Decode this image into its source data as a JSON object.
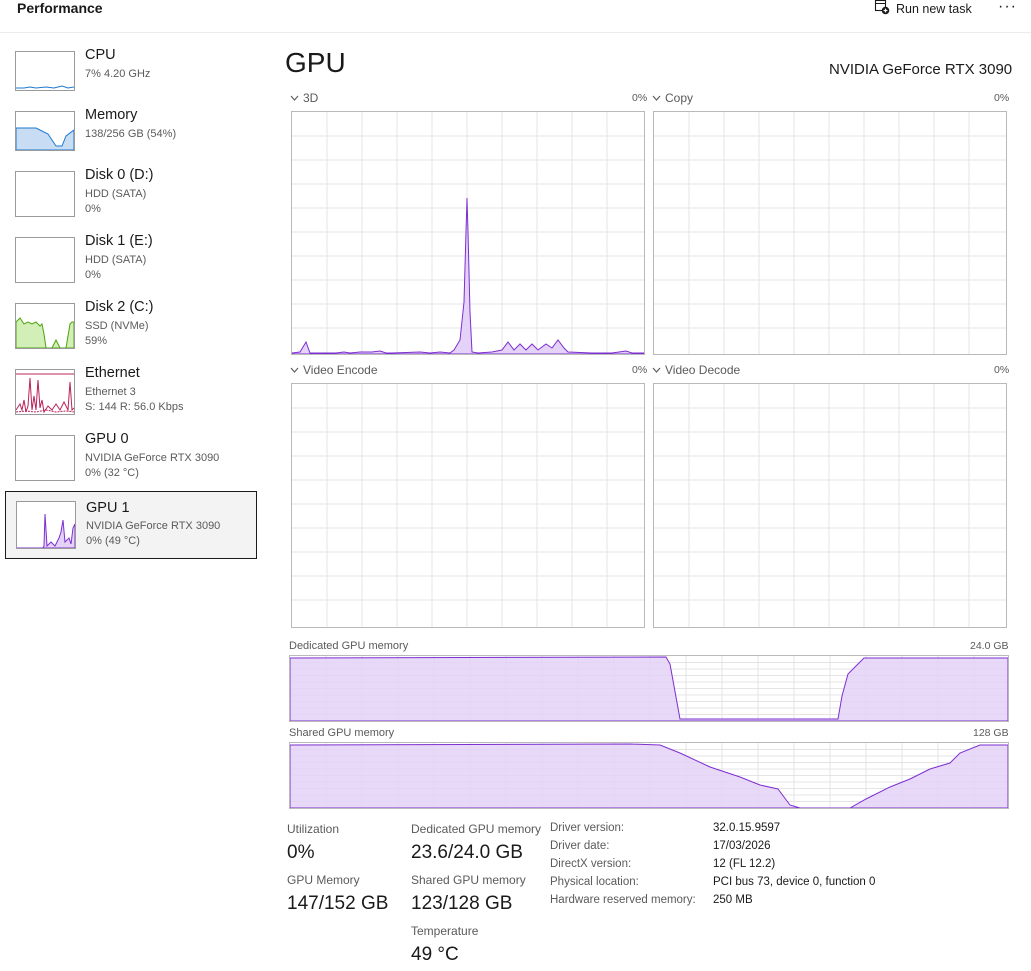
{
  "header": {
    "title": "Performance",
    "run_new_task_label": "Run new task",
    "more_label": "···"
  },
  "sidebar": {
    "items": [
      {
        "title": "CPU",
        "sub1": "7%  4.20 GHz",
        "sub2": ""
      },
      {
        "title": "Memory",
        "sub1": "138/256 GB (54%)",
        "sub2": ""
      },
      {
        "title": "Disk 0 (D:)",
        "sub1": "HDD (SATA)",
        "sub2": "0%"
      },
      {
        "title": "Disk 1 (E:)",
        "sub1": "HDD (SATA)",
        "sub2": "0%"
      },
      {
        "title": "Disk 2 (C:)",
        "sub1": "SSD (NVMe)",
        "sub2": "59%"
      },
      {
        "title": "Ethernet",
        "sub1": "Ethernet 3",
        "sub2": "S: 144  R: 56.0 Kbps"
      },
      {
        "title": "GPU 0",
        "sub1": "NVIDIA GeForce RTX 3090",
        "sub2": "0%  (32 °C)"
      },
      {
        "title": "GPU 1",
        "sub1": "NVIDIA GeForce RTX 3090",
        "sub2": "0%  (49 °C)"
      }
    ],
    "selected_index": 7
  },
  "main": {
    "title": "GPU",
    "model": "NVIDIA GeForce RTX 3090",
    "engines": [
      {
        "name": "3D",
        "percent": "0%"
      },
      {
        "name": "Copy",
        "percent": "0%"
      },
      {
        "name": "Video Encode",
        "percent": "0%"
      },
      {
        "name": "Video Decode",
        "percent": "0%"
      }
    ],
    "dedicated_memory": {
      "label": "Dedicated GPU memory",
      "max": "24.0 GB"
    },
    "shared_memory": {
      "label": "Shared GPU memory",
      "max": "128 GB"
    },
    "stats": {
      "utilization_label": "Utilization",
      "utilization": "0%",
      "gpu_memory_label": "GPU Memory",
      "gpu_memory": "147/152 GB",
      "dedicated_label": "Dedicated GPU memory",
      "dedicated": "23.6/24.0 GB",
      "shared_label": "Shared GPU memory",
      "shared": "123/128 GB",
      "temperature_label": "Temperature",
      "temperature": "49 °C"
    },
    "info": [
      {
        "key": "Driver version:",
        "value": "32.0.15.9597"
      },
      {
        "key": "Driver date:",
        "value": "17/03/2026"
      },
      {
        "key": "DirectX version:",
        "value": "12 (FL 12.2)"
      },
      {
        "key": "Physical location:",
        "value": "PCI bus 73, device 0, function 0"
      },
      {
        "key": "Hardware reserved memory:",
        "value": "250 MB"
      }
    ]
  },
  "colors": {
    "gpu_line": "#7c2fd0",
    "gpu_fill": "#e4d2f8",
    "cpu_line": "#1b7ad1",
    "memory_fill": "#c8dcf4",
    "disk_line": "#4da30d",
    "disk_fill": "#d3efb8",
    "ethernet_line": "#b8235a",
    "selected_bg": "#f3f3f3"
  },
  "icons": {
    "run_task": "run-task-icon",
    "chevron": "chevron-down-icon"
  }
}
